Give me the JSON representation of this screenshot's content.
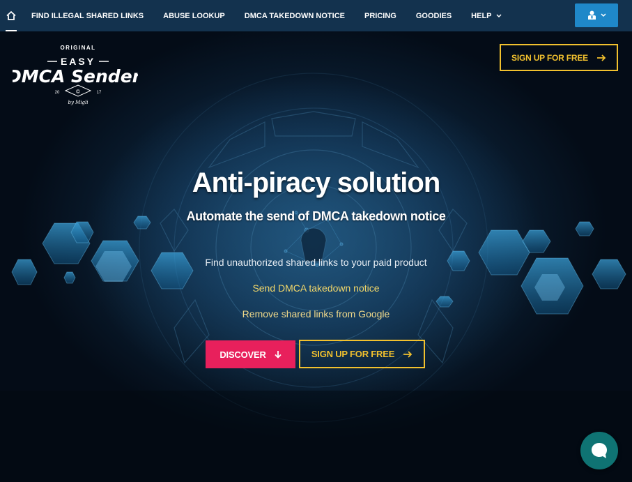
{
  "nav": {
    "home_icon": "home-icon",
    "items": [
      {
        "label": "FIND ILLEGAL SHARED LINKS"
      },
      {
        "label": "ABUSE LOOKUP"
      },
      {
        "label": "DMCA TAKEDOWN NOTICE"
      },
      {
        "label": "PRICING"
      },
      {
        "label": "GOODIES"
      },
      {
        "label": "HELP",
        "has_dropdown": true
      }
    ],
    "user_menu_icon": "user-icon"
  },
  "logo": {
    "top_text": "ORIGINAL",
    "line1": "EASY",
    "line2": "DMCA Sender",
    "year_left": "20",
    "year_right": "17",
    "symbol": "©",
    "byline": "by Migli"
  },
  "header": {
    "signup_label": "SIGN UP FOR FREE"
  },
  "hero": {
    "title": "Anti-piracy solution",
    "subtitle": "Automate the send of DMCA takedown notice",
    "features": [
      "Find unauthorized shared links to your paid product",
      "Send DMCA takedown notice",
      "Remove shared links from Google"
    ],
    "discover_label": "DISCOVER",
    "signup_label": "SIGN UP FOR FREE"
  },
  "colors": {
    "nav_bg": "#13324e",
    "accent_yellow": "#f2c12e",
    "discover_pink": "#e8205c",
    "user_button_blue": "#1f88c9",
    "chat_teal": "#0f7373"
  },
  "chat": {
    "icon": "chat-bubble-icon"
  }
}
